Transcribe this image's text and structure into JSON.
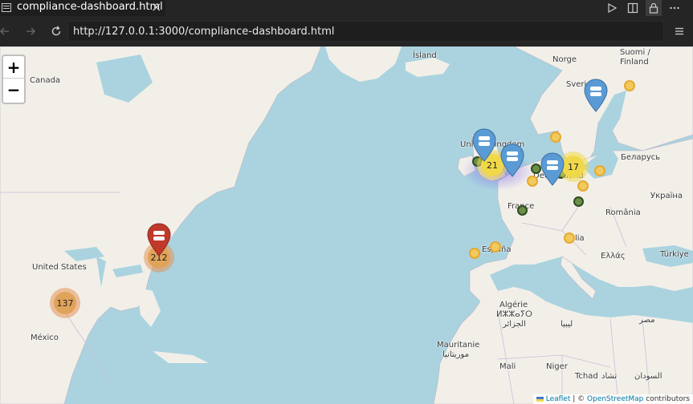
{
  "tab": {
    "title": "compliance-dashboard.html",
    "close": "×"
  },
  "address": {
    "url": "http://127.0.0.1:3000/compliance-dashboard.html"
  },
  "map": {
    "zoom_in": "+",
    "zoom_out": "−",
    "labels": {
      "island": "Ísland",
      "norge": "Norge",
      "suomi": "Suomi /",
      "finland": "Finland",
      "sverige": "Sveri",
      "canada": "Canada",
      "united_kingdom": "United Kingdom",
      "deutschland": "Deutschland",
      "belarus": "Беларусь",
      "ukraina": "Україна",
      "france": "France",
      "romania": "România",
      "espana": "España",
      "italia": "Italia",
      "ellas": "Ελλάς",
      "turkiye": "Türkiye",
      "united_states": "United States",
      "mexico": "México",
      "algerie": "Algérie",
      "algerie_tifinagh": "ⵍⵣⵣⴰⵢⵔ",
      "algerie_ar": "الجزائر",
      "libya": "ليبيا",
      "misr": "مصر",
      "mauritanie": "Mauritanie",
      "mauritania_ar": "موريتانيا",
      "mali": "Mali",
      "niger": "Niger",
      "tchad": "Tchad",
      "tchad_ar": "تشاد",
      "sudan": "السودان"
    },
    "clusters": [
      {
        "count": "212",
        "color": "#e59457"
      },
      {
        "count": "137",
        "color": "#e59457"
      },
      {
        "count": "21",
        "color": "#f0d949"
      },
      {
        "count": "17",
        "color": "#f0d949"
      }
    ],
    "attribution": {
      "leaflet": "Leaflet",
      "sep": " | © ",
      "osm": "OpenStreetMap",
      "contrib": " contributors"
    }
  }
}
